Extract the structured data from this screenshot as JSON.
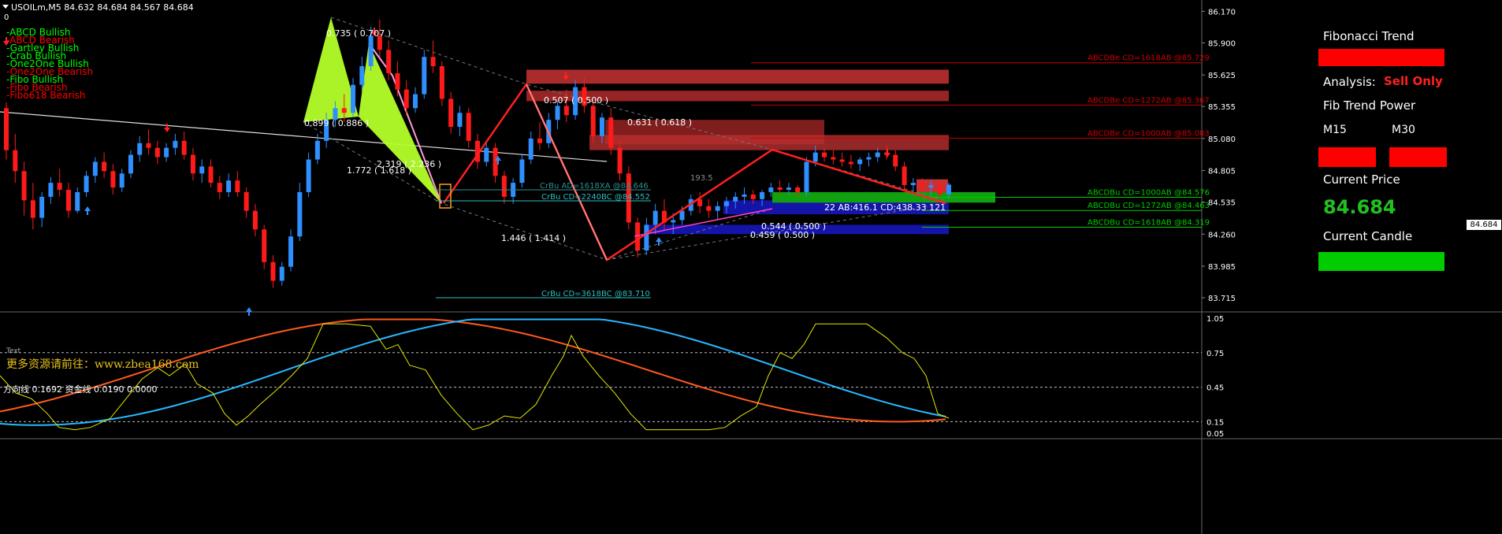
{
  "header": {
    "symbol_line": "USOILm,M5  84.632 84.684 84.567 84.684",
    "zero_label": "0"
  },
  "legend": [
    {
      "label": "-ABCD Bullish",
      "color": "#00ff00"
    },
    {
      "label": "-ABCD Bearish",
      "color": "#ff0000"
    },
    {
      "label": "-Gartley Bullish",
      "color": "#00ff00"
    },
    {
      "label": "-Crab Bullish",
      "color": "#00ff00"
    },
    {
      "label": "-One2One Bullish",
      "color": "#00ff00"
    },
    {
      "label": "-One2One Bearish",
      "color": "#ff0000"
    },
    {
      "label": "-Fibo Bullish",
      "color": "#00ff00"
    },
    {
      "label": "-Fibo Bearish",
      "color": "#ff0000"
    },
    {
      "label": "-Fibo618 Bearish",
      "color": "#ff0000"
    }
  ],
  "side_panel": {
    "title": "Fibonacci Trend",
    "analysis_label": "Analysis:",
    "analysis_value": "Sell Only",
    "power_label": "Fib Trend Power",
    "tf1": "M15",
    "tf2": "M30",
    "current_price_label": "Current Price",
    "current_price_value": "84.684",
    "current_candle_label": "Current Candle"
  },
  "watermark": "更多资源请前往：www.zbea168.com",
  "text_tag": "Text",
  "oscillator": {
    "header": "方向线 0.1692  资金线 0.0190 0.0000",
    "axis": [
      "1.05",
      "0.75",
      "0.45",
      "0.15",
      "0.05"
    ]
  },
  "chart_data": {
    "type": "candlestick",
    "symbol": "USOILm",
    "timeframe": "M5",
    "ylim": [
      83.6,
      86.2
    ],
    "price_axis": [
      "86.170",
      "85.900",
      "85.625",
      "85.355",
      "85.080",
      "84.805",
      "84.535",
      "84.260",
      "83.985",
      "83.715"
    ],
    "last_price": "84.684",
    "candles": [
      [
        85.34,
        85.39,
        84.9,
        84.98
      ],
      [
        84.98,
        85.12,
        84.7,
        84.8
      ],
      [
        84.8,
        84.88,
        84.42,
        84.55
      ],
      [
        84.55,
        84.7,
        84.3,
        84.4
      ],
      [
        84.4,
        84.62,
        84.32,
        84.58
      ],
      [
        84.58,
        84.75,
        84.52,
        84.7
      ],
      [
        84.7,
        84.82,
        84.58,
        84.64
      ],
      [
        84.64,
        84.7,
        84.4,
        84.46
      ],
      [
        84.46,
        84.66,
        84.44,
        84.62
      ],
      [
        84.62,
        84.8,
        84.58,
        84.76
      ],
      [
        84.76,
        84.92,
        84.7,
        84.88
      ],
      [
        84.88,
        84.96,
        84.74,
        84.8
      ],
      [
        84.8,
        84.86,
        84.6,
        84.66
      ],
      [
        84.66,
        84.82,
        84.62,
        84.78
      ],
      [
        84.78,
        84.98,
        84.74,
        84.94
      ],
      [
        84.94,
        85.1,
        84.88,
        85.04
      ],
      [
        85.04,
        85.16,
        84.94,
        85.0
      ],
      [
        85.0,
        85.06,
        84.86,
        84.92
      ],
      [
        84.92,
        85.04,
        84.88,
        85.0
      ],
      [
        85.0,
        85.12,
        84.94,
        85.06
      ],
      [
        85.06,
        85.14,
        84.9,
        84.94
      ],
      [
        84.94,
        85.0,
        84.72,
        84.78
      ],
      [
        84.78,
        84.9,
        84.7,
        84.84
      ],
      [
        84.84,
        84.9,
        84.66,
        84.7
      ],
      [
        84.7,
        84.76,
        84.56,
        84.62
      ],
      [
        84.62,
        84.78,
        84.58,
        84.72
      ],
      [
        84.72,
        84.8,
        84.58,
        84.62
      ],
      [
        84.62,
        84.66,
        84.4,
        84.46
      ],
      [
        84.46,
        84.52,
        84.24,
        84.3
      ],
      [
        84.3,
        84.34,
        83.96,
        84.02
      ],
      [
        84.02,
        84.08,
        83.8,
        83.86
      ],
      [
        83.86,
        84.02,
        83.82,
        83.98
      ],
      [
        83.98,
        84.3,
        83.94,
        84.24
      ],
      [
        84.24,
        84.7,
        84.2,
        84.62
      ],
      [
        84.62,
        84.96,
        84.58,
        84.9
      ],
      [
        84.9,
        85.12,
        84.86,
        85.06
      ],
      [
        85.06,
        85.3,
        85.0,
        85.24
      ],
      [
        85.24,
        85.4,
        85.18,
        85.34
      ],
      [
        85.34,
        85.46,
        85.22,
        85.3
      ],
      [
        85.3,
        85.6,
        85.26,
        85.54
      ],
      [
        85.54,
        85.78,
        85.48,
        85.7
      ],
      [
        85.7,
        86.04,
        85.66,
        85.96
      ],
      [
        85.96,
        86.1,
        85.78,
        85.84
      ],
      [
        85.84,
        85.92,
        85.58,
        85.64
      ],
      [
        85.64,
        85.74,
        85.44,
        85.5
      ],
      [
        85.5,
        85.58,
        85.28,
        85.34
      ],
      [
        85.34,
        85.52,
        85.3,
        85.46
      ],
      [
        85.46,
        85.84,
        85.42,
        85.78
      ],
      [
        85.78,
        85.92,
        85.64,
        85.7
      ],
      [
        85.7,
        85.74,
        85.36,
        85.42
      ],
      [
        85.42,
        85.48,
        85.12,
        85.18
      ],
      [
        85.18,
        85.36,
        85.1,
        85.3
      ],
      [
        85.3,
        85.34,
        85.0,
        85.06
      ],
      [
        85.06,
        85.12,
        84.82,
        84.88
      ],
      [
        84.88,
        85.04,
        84.84,
        85.0
      ],
      [
        85.0,
        85.04,
        84.7,
        84.76
      ],
      [
        84.76,
        84.8,
        84.52,
        84.58
      ],
      [
        84.58,
        84.74,
        84.52,
        84.7
      ],
      [
        84.7,
        84.94,
        84.66,
        84.9
      ],
      [
        84.9,
        85.14,
        84.86,
        85.08
      ],
      [
        85.08,
        85.22,
        84.98,
        85.04
      ],
      [
        85.04,
        85.3,
        85.0,
        85.24
      ],
      [
        85.24,
        85.4,
        85.16,
        85.36
      ],
      [
        85.36,
        85.5,
        85.22,
        85.28
      ],
      [
        85.28,
        85.58,
        85.24,
        85.52
      ],
      [
        85.52,
        85.6,
        85.3,
        85.36
      ],
      [
        85.36,
        85.4,
        85.04,
        85.1
      ],
      [
        85.1,
        85.3,
        85.04,
        85.26
      ],
      [
        85.26,
        85.34,
        84.94,
        85.0
      ],
      [
        85.0,
        85.06,
        84.72,
        84.78
      ],
      [
        84.78,
        84.84,
        84.3,
        84.36
      ],
      [
        84.36,
        84.4,
        84.06,
        84.12
      ],
      [
        84.12,
        84.4,
        84.08,
        84.34
      ],
      [
        84.34,
        84.52,
        84.26,
        84.46
      ],
      [
        84.46,
        84.56,
        84.3,
        84.36
      ],
      [
        84.36,
        84.44,
        84.26,
        84.38
      ],
      [
        84.38,
        84.5,
        84.34,
        84.46
      ],
      [
        84.46,
        84.6,
        84.42,
        84.56
      ],
      [
        84.56,
        84.62,
        84.44,
        84.5
      ],
      [
        84.5,
        84.56,
        84.4,
        84.46
      ],
      [
        84.46,
        84.54,
        84.38,
        84.5
      ],
      [
        84.5,
        84.58,
        84.44,
        84.54
      ],
      [
        84.54,
        84.62,
        84.48,
        84.58
      ],
      [
        84.58,
        84.66,
        84.52,
        84.6
      ],
      [
        84.6,
        84.64,
        84.52,
        84.56
      ],
      [
        84.56,
        84.64,
        84.5,
        84.62
      ],
      [
        84.62,
        84.7,
        84.58,
        84.66
      ],
      [
        84.66,
        84.72,
        84.6,
        84.64
      ],
      [
        84.64,
        84.7,
        84.6,
        84.66
      ],
      [
        84.66,
        84.68,
        84.58,
        84.62
      ],
      [
        84.62,
        84.92,
        84.58,
        84.88
      ],
      [
        84.88,
        85.02,
        84.84,
        84.96
      ],
      [
        84.96,
        85.0,
        84.88,
        84.92
      ],
      [
        84.92,
        84.98,
        84.86,
        84.9
      ],
      [
        84.9,
        84.96,
        84.84,
        84.88
      ],
      [
        84.88,
        84.94,
        84.82,
        84.86
      ],
      [
        84.86,
        84.92,
        84.8,
        84.9
      ],
      [
        84.9,
        84.96,
        84.84,
        84.92
      ],
      [
        84.92,
        85.0,
        84.88,
        84.96
      ],
      [
        84.96,
        85.02,
        84.9,
        84.94
      ],
      [
        84.94,
        84.98,
        84.8,
        84.84
      ],
      [
        84.84,
        84.88,
        84.64,
        84.68
      ],
      [
        84.68,
        84.74,
        84.6,
        84.7
      ],
      [
        84.7,
        84.74,
        84.62,
        84.66
      ],
      [
        84.66,
        84.72,
        84.6,
        84.68
      ],
      [
        84.68,
        84.72,
        84.56,
        84.6
      ],
      [
        84.6,
        84.7,
        84.56,
        84.684
      ]
    ],
    "annotations": [
      {
        "text": "0.735 ( 0.707 )",
        "color": "#ffffff"
      },
      {
        "text": "0.899 ( 0.886 )",
        "color": "#ffffff"
      },
      {
        "text": "1.772 ( 1.618 )",
        "color": "#ffffff"
      },
      {
        "text": "2.319 ( 2.236 )",
        "color": "#ffffff"
      },
      {
        "text": "0.507 ( 0.500 )",
        "color": "#ffffff"
      },
      {
        "text": "0.631 ( 0.618 )",
        "color": "#ffffff"
      },
      {
        "text": "1.446 ( 1.414 )",
        "color": "#ffffff"
      },
      {
        "text": "0.544 ( 0.500 )",
        "color": "#ffffff"
      },
      {
        "text": "0.459 ( 0.500 )",
        "color": "#ffffff"
      },
      {
        "text": "193.5",
        "color": "#888888"
      },
      {
        "text": "22   AB:416.1 CD:438.33   121",
        "color": "#ffffff"
      },
      {
        "text": "CrBu AD=1618XA   @84.646",
        "color": "#2f8f8f"
      },
      {
        "text": "CrBu CD=2240BC   @84.552",
        "color": "#2fbfbf"
      },
      {
        "text": "CrBu CD=3618BC   @83.710",
        "color": "#2fbfbf"
      }
    ],
    "levels": [
      {
        "label": "ABCDBe CD=1618AB   @85.729",
        "price": 85.729,
        "color": "#cc0000"
      },
      {
        "label": "ABCDBe CD=1272AB   @85.367",
        "price": 85.367,
        "color": "#cc0000"
      },
      {
        "label": "ABCDBe CD=1000AB   @85.083",
        "price": 85.083,
        "color": "#cc0000"
      },
      {
        "label": "ABCDBu CD=1000AB   @84.576",
        "price": 84.576,
        "color": "#00cc00"
      },
      {
        "label": "ABCDBu CD=1272AB   @84.463",
        "price": 84.463,
        "color": "#00cc00"
      },
      {
        "label": "ABCDBu CD=1618AB   @84.319",
        "price": 84.319,
        "color": "#00cc00"
      }
    ],
    "oscillator_ylim": [
      0.05,
      1.05
    ]
  }
}
